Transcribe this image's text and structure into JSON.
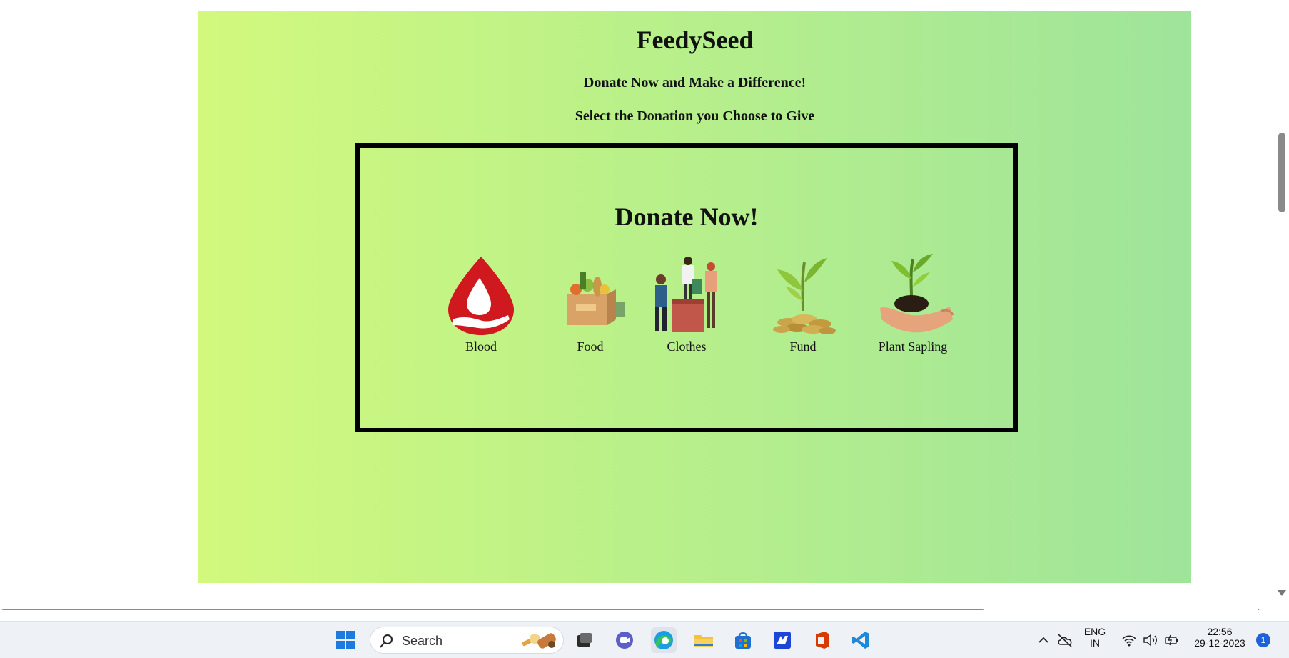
{
  "site": {
    "title": "FeedySeed",
    "tagline": "Donate Now and Make a Difference!",
    "subtitle": "Select the Donation you Choose to Give"
  },
  "donate_box": {
    "heading": "Donate Now!",
    "items": [
      {
        "label": "Blood",
        "icon": "blood-drop-icon"
      },
      {
        "label": "Food",
        "icon": "food-box-icon"
      },
      {
        "label": "Clothes",
        "icon": "clothes-donation-icon"
      },
      {
        "label": "Fund",
        "icon": "coins-plant-icon"
      },
      {
        "label": "Plant Sapling",
        "icon": "sapling-hand-icon"
      }
    ]
  },
  "taskbar": {
    "search_placeholder": "Search",
    "language": "ENG",
    "region": "IN",
    "time": "22:56",
    "date": "29-12-2023",
    "notifications": "1"
  }
}
